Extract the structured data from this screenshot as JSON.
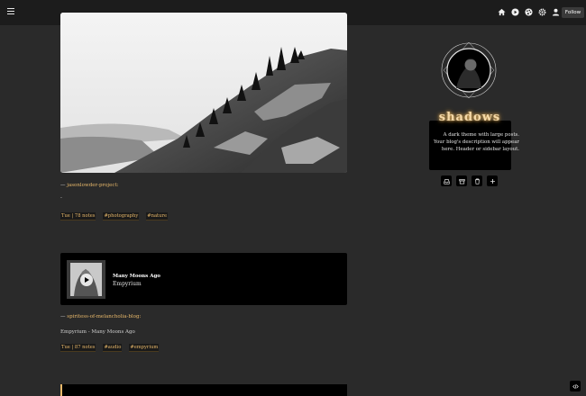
{
  "topbar": {
    "icons": [
      "home-icon",
      "play-icon",
      "palette-icon",
      "gear-icon",
      "user-icon"
    ],
    "follow_label": "Follow"
  },
  "posts": [
    {
      "type": "photo",
      "credit_prefix": "—",
      "credit_blog": "jasonlowder-project:",
      "body": "-",
      "meta": {
        "date": "Tue | 78 notes",
        "tags": [
          "#photography",
          "#nature"
        ]
      }
    },
    {
      "type": "audio",
      "track": "Many Moons Ago",
      "artist": "Empyrium",
      "credit_prefix": "—",
      "credit_blog": "spiritess-of-melancholia-blog:",
      "body": "Empyrium - Many Moons Ago",
      "meta": {
        "date": "Tue | 87 notes",
        "tags": [
          "#audio",
          "#empyrium"
        ]
      }
    }
  ],
  "sidebar": {
    "title": "shadows",
    "description": "A dark theme with large posts. Your blog's description will appear here. Header or sidebar layout.",
    "buttons": [
      "inbox-icon",
      "archive-icon",
      "trash-icon",
      "plus-icon"
    ]
  },
  "colors": {
    "background": "#2a2a2a",
    "topbar": "#1c1c1c",
    "accent": "#e8b86a",
    "card": "#000000"
  }
}
